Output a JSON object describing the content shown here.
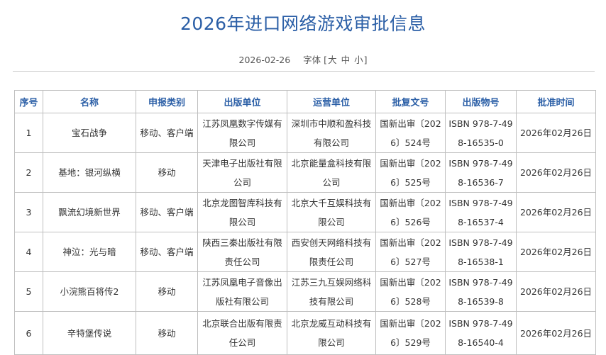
{
  "page": {
    "title": "2026年进口网络游戏审批信息",
    "date": "2026-02-26",
    "font_label": "字体",
    "font_open": "[",
    "font_large": "大",
    "font_medium": "中",
    "font_small": "小",
    "font_close": "]"
  },
  "colors": {
    "title": "#2a5ea6",
    "header_text": "#2a5ea6",
    "border": "#bfbfbf"
  },
  "table": {
    "headers": [
      "序号",
      "名称",
      "申报类别",
      "出版单位",
      "运营单位",
      "批复文号",
      "出版物号",
      "批准时间"
    ],
    "rows": [
      [
        "1",
        "宝石战争",
        "移动、客户端",
        "江苏凤凰数字传媒有限公司",
        "深圳市中顺和盈科技有限公司",
        "国新出审〔2026〕524号",
        "ISBN 978-7-498-16535-0",
        "2026年02月26日"
      ],
      [
        "2",
        "基地：银河纵横",
        "移动",
        "天津电子出版社有限公司",
        "北京能量盒科技有限公司",
        "国新出审〔2026〕525号",
        "ISBN 978-7-498-16536-7",
        "2026年02月26日"
      ],
      [
        "3",
        "飘流幻境新世界",
        "移动、客户端",
        "北京龙图智库科技有限公司",
        "北京大千互娱科技有限公司",
        "国新出审〔2026〕526号",
        "ISBN 978-7-498-16537-4",
        "2026年02月26日"
      ],
      [
        "4",
        "神泣：光与暗",
        "移动、客户端",
        "陕西三秦出版社有限责任公司",
        "西安创天网络科技有限责任公司",
        "国新出审〔2026〕527号",
        "ISBN 978-7-498-16538-1",
        "2026年02月26日"
      ],
      [
        "5",
        "小浣熊百将传2",
        "移动",
        "江苏凤凰电子音像出版社有限公司",
        "江苏三九互娱网络科技有限公司",
        "国新出审〔2026〕528号",
        "ISBN 978-7-498-16539-8",
        "2026年02月26日"
      ],
      [
        "6",
        "辛特堡传说",
        "移动",
        "北京联合出版有限责任公司",
        "北京龙威互动科技有限公司",
        "国新出审〔2026〕529号",
        "ISBN 978-7-498-16540-4",
        "2026年02月26日"
      ]
    ]
  }
}
